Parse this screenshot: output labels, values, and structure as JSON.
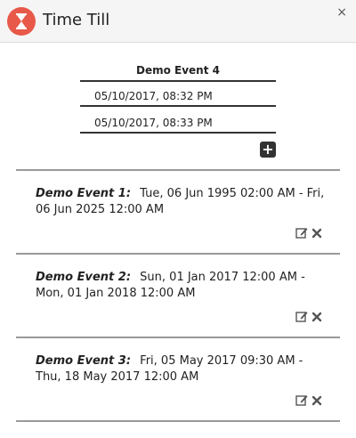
{
  "window": {
    "title": "Time Till",
    "close_label": "×"
  },
  "form": {
    "event_name": "Demo Event 4",
    "start": "05/10/2017, 08:32 PM",
    "end": "05/10/2017, 08:33 PM",
    "add_label": "+"
  },
  "events": [
    {
      "name": "Demo Event 1:",
      "range": "Tue, 06 Jun 1995 02:00 AM - Fri, 06 Jun 2025 12:00 AM"
    },
    {
      "name": "Demo Event 2:",
      "range": "Sun, 01 Jan 2017 12:00 AM - Mon, 01 Jan 2018 12:00 AM"
    },
    {
      "name": "Demo Event 3:",
      "range": "Fri, 05 May 2017 09:30 AM - Thu, 18 May 2017 12:00 AM"
    }
  ],
  "icons": {
    "app": "hourglass-icon",
    "close": "close-icon",
    "add": "plus-square-icon",
    "edit": "edit-icon",
    "delete": "delete-icon"
  },
  "colors": {
    "accent": "#e8594a",
    "icon": "#555555"
  }
}
